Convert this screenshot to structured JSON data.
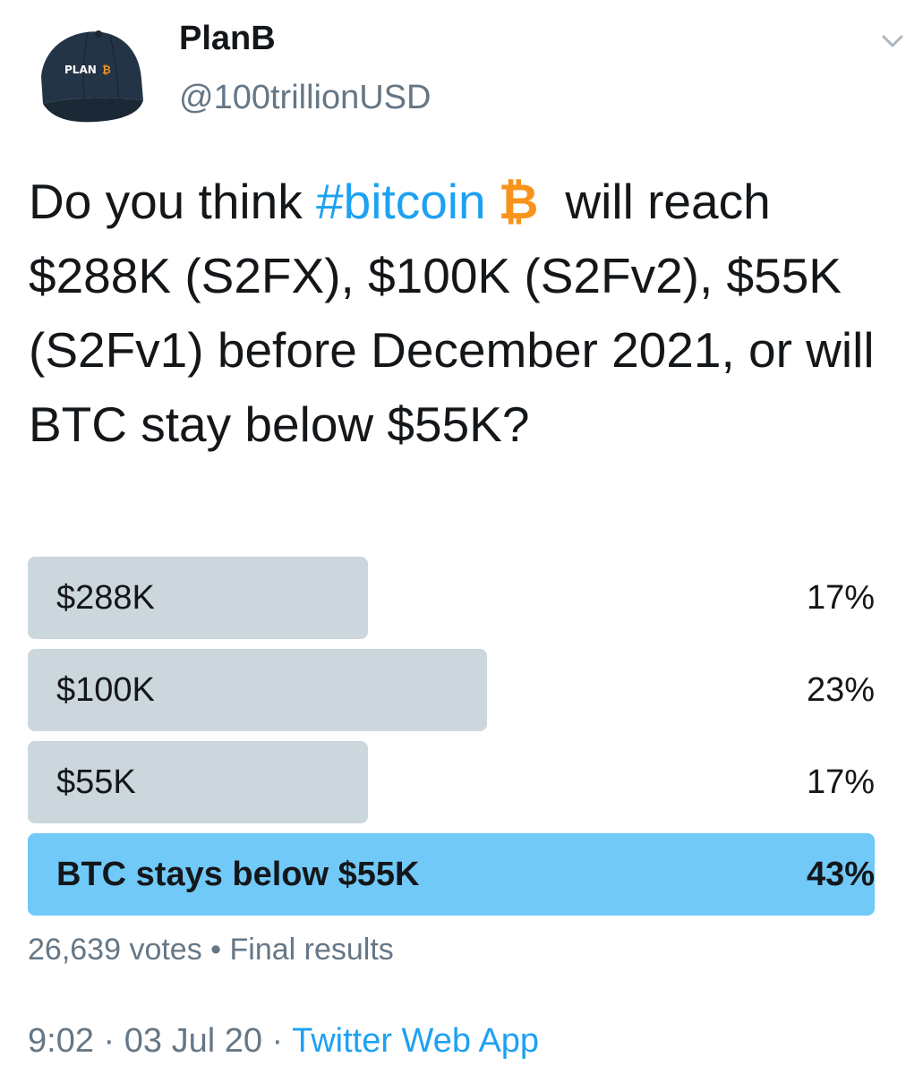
{
  "author": {
    "display_name": "PlanB",
    "handle": "@100trillionUSD",
    "avatar_text": "PLAN"
  },
  "tweet": {
    "text_before_hashtag": "Do you think ",
    "hashtag": "#bitcoin",
    "bitcoin_glyph": "₿",
    "text_after": "will reach $288K (S2FX), $100K (S2Fv2), $55K (S2Fv1) before December 2021, or will BTC stay below $55K?"
  },
  "poll": {
    "options": [
      {
        "label": "$288K",
        "percent": "17%",
        "share": 0.17,
        "winner": false
      },
      {
        "label": "$100K",
        "percent": "23%",
        "share": 0.23,
        "winner": false
      },
      {
        "label": "$55K",
        "percent": "17%",
        "share": 0.17,
        "winner": false
      },
      {
        "label": "BTC stays below $55K",
        "percent": "43%",
        "share": 0.43,
        "winner": true
      }
    ],
    "votes": "26,639 votes",
    "separator": "•",
    "status": "Final results"
  },
  "footer": {
    "time": "9:02",
    "dot": "·",
    "date": "03 Jul 20",
    "source": "Twitter Web App"
  },
  "colors": {
    "link": "#1da1f2",
    "bitcoin": "#f7931a",
    "bar": "#ccd6dd",
    "winner_bar": "#71c9f8",
    "muted": "#657786"
  },
  "icons": {
    "caret": "chevron-down-icon",
    "avatar": "baseball-cap-avatar"
  }
}
